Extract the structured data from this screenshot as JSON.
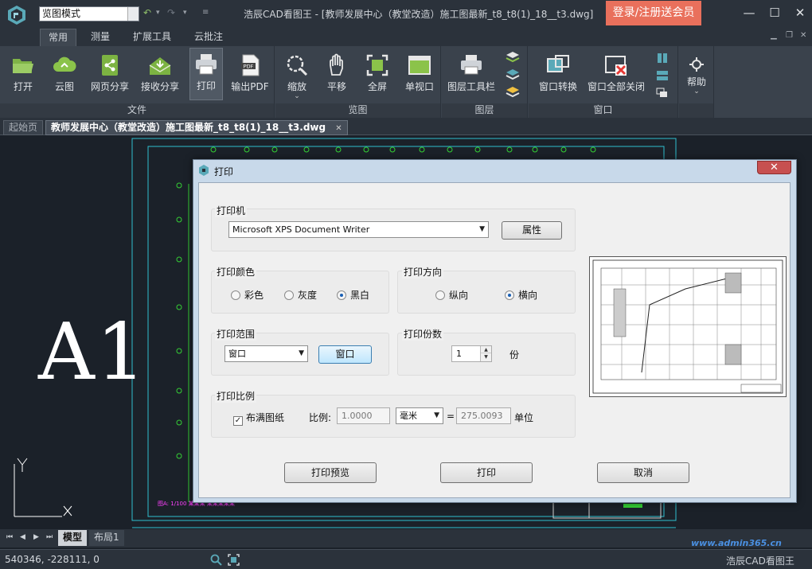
{
  "titlebar": {
    "mode": "览图模式",
    "title": "浩辰CAD看图王 - [教师发展中心（教堂改造）施工图最新_t8_t8(1)_18__t3.dwg]",
    "login": "登录/注册送会员",
    "minimize": "—",
    "maximize": "☐",
    "close": "✕"
  },
  "ribbon_tabs": [
    "常用",
    "测量",
    "扩展工具",
    "云批注"
  ],
  "mdi_controls": [
    "▁",
    "❐",
    "✕"
  ],
  "ribbon": {
    "groups": [
      {
        "label": "文件",
        "buttons": [
          "打开",
          "云图",
          "网页分享",
          "接收分享",
          "打印",
          "输出PDF"
        ]
      },
      {
        "label": "览图",
        "buttons": [
          "缩放",
          "平移",
          "全屏",
          "单视口"
        ]
      },
      {
        "label": "图层",
        "buttons": [
          "图层工具栏"
        ]
      },
      {
        "label": "窗口",
        "buttons": [
          "窗口转换",
          "窗口全部关闭"
        ]
      },
      {
        "label": "",
        "buttons": [
          "帮助"
        ]
      }
    ],
    "zoom_caret": "⌄",
    "help_caret": "⌄",
    "pdf_badge": "PDF"
  },
  "doc_tabs": {
    "home": "起始页",
    "current": "教师发展中心（教堂改造）施工图最新_t8_t8(1)_18__t3.dwg",
    "close": "✕"
  },
  "canvas": {
    "big_label": "A1",
    "axis_y": "Y",
    "axis_x": "X",
    "drawing_note": "图A: 1/100 某某某 某某某某某"
  },
  "layout_tabs": {
    "model": "模型",
    "layout1": "布局1",
    "nav": [
      "⏮",
      "◀",
      "▶",
      "⏭"
    ]
  },
  "status": {
    "coords": "540346, -228111, 0",
    "app_name": "浩辰CAD看图王",
    "watermark": "www.admin365.cn"
  },
  "dialog": {
    "title": "打印",
    "close": "✕",
    "printer": {
      "label": "打印机",
      "value": "Microsoft XPS Document Writer",
      "props_button": "属性"
    },
    "color": {
      "label": "打印颜色",
      "options": [
        "彩色",
        "灰度",
        "黑白"
      ],
      "selected": 2
    },
    "orientation": {
      "label": "打印方向",
      "options": [
        "纵向",
        "横向"
      ],
      "selected": 1
    },
    "range": {
      "label": "打印范围",
      "value": "窗口",
      "window_button": "窗口"
    },
    "copies": {
      "label": "打印份数",
      "value": "1",
      "unit": "份"
    },
    "scale": {
      "label": "打印比例",
      "fit_label": "布满图纸",
      "fit_checked": true,
      "ratio_label": "比例:",
      "ratio_value": "1.0000",
      "unit_value": "毫米",
      "equals": "=",
      "units_value": "275.0093",
      "units_label": "单位"
    },
    "buttons": {
      "preview": "打印预览",
      "print": "打印",
      "cancel": "取消"
    }
  }
}
